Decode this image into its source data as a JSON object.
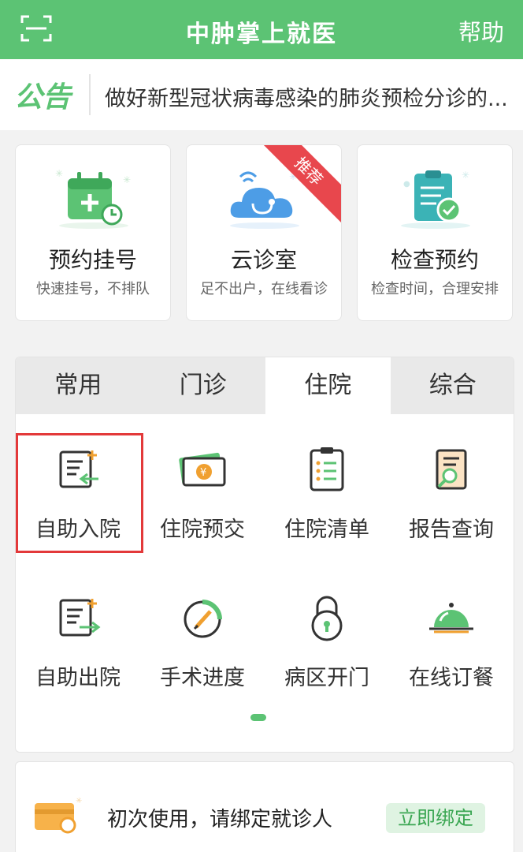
{
  "header": {
    "title": "中肿掌上就医",
    "help_label": "帮助",
    "scan_icon": "scan-icon"
  },
  "notice": {
    "logo_text": "公告",
    "text": "做好新型冠状病毒感染的肺炎预检分诊的..."
  },
  "features": [
    {
      "title": "预约挂号",
      "subtitle": "快速挂号，不排队",
      "icon": "calendar-add-icon"
    },
    {
      "title": "云诊室",
      "subtitle": "足不出户，在线看诊",
      "icon": "cloud-stethoscope-icon",
      "badge": "推荐"
    },
    {
      "title": "检查预约",
      "subtitle": "检查时间，合理安排",
      "icon": "clipboard-check-icon"
    }
  ],
  "tabs": [
    {
      "label": "常用",
      "active": false
    },
    {
      "label": "门诊",
      "active": false
    },
    {
      "label": "住院",
      "active": true
    },
    {
      "label": "综合",
      "active": false
    }
  ],
  "services": [
    {
      "label": "自助入院",
      "icon": "admission-icon",
      "highlighted": true
    },
    {
      "label": "住院预交",
      "icon": "money-icon"
    },
    {
      "label": "住院清单",
      "icon": "list-icon"
    },
    {
      "label": "报告查询",
      "icon": "report-search-icon"
    },
    {
      "label": "自助出院",
      "icon": "discharge-icon"
    },
    {
      "label": "手术进度",
      "icon": "surgery-progress-icon"
    },
    {
      "label": "病区开门",
      "icon": "lock-icon"
    },
    {
      "label": "在线订餐",
      "icon": "meal-cloche-icon"
    }
  ],
  "pager": {
    "pages": 1,
    "current": 1
  },
  "bind_prompt": {
    "text": "初次使用，请绑定就诊人",
    "button_label": "立即绑定",
    "icon": "card-link-icon"
  },
  "colors": {
    "primary": "#5cc374",
    "highlight": "#e3393a",
    "badge": "#e8474d"
  }
}
